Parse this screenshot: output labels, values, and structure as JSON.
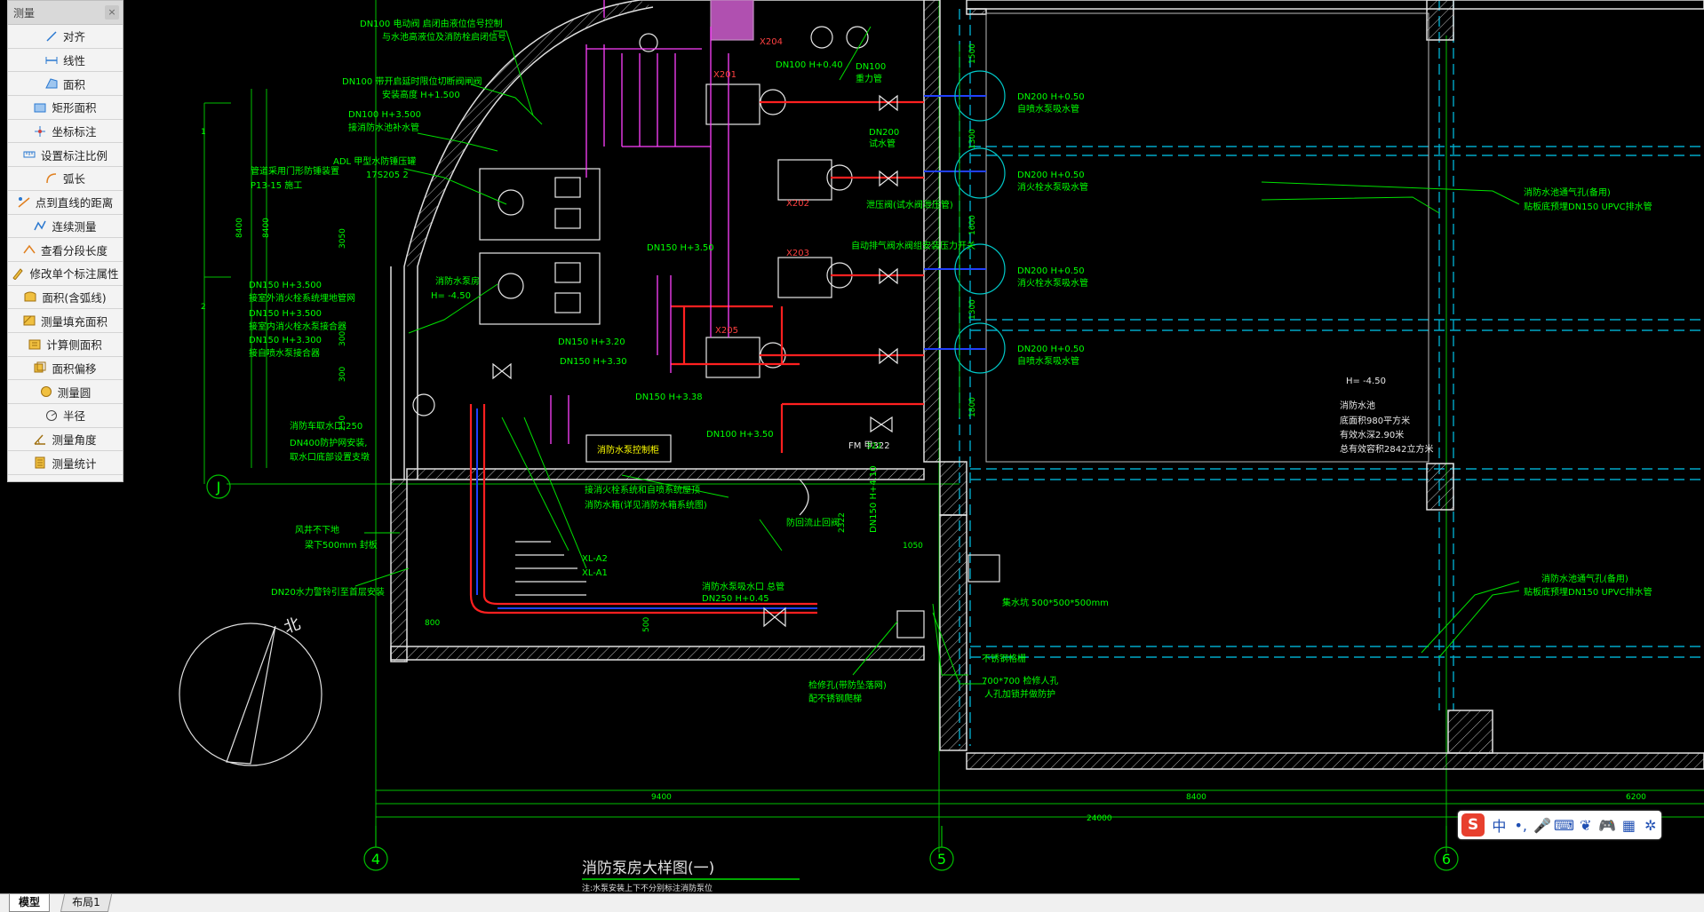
{
  "measure_panel": {
    "title": "测量",
    "close_label": "×",
    "tools": [
      {
        "label": "对齐",
        "icon": "align-icon"
      },
      {
        "label": "线性",
        "icon": "linear-icon"
      },
      {
        "label": "面积",
        "icon": "area-icon"
      },
      {
        "label": "矩形面积",
        "icon": "rect-area-icon"
      },
      {
        "label": "坐标标注",
        "icon": "coordinate-icon"
      },
      {
        "label": "设置标注比例",
        "icon": "scale-icon"
      },
      {
        "label": "弧长",
        "icon": "arc-length-icon"
      },
      {
        "label": "点到直线的距离",
        "icon": "point-line-icon"
      },
      {
        "label": "连续测量",
        "icon": "continuous-icon"
      },
      {
        "label": "查看分段长度",
        "icon": "segment-icon"
      },
      {
        "label": "修改单个标注属性",
        "icon": "edit-dim-icon"
      },
      {
        "label": "面积(含弧线)",
        "icon": "arc-area-icon"
      },
      {
        "label": "测量填充面积",
        "icon": "hatch-area-icon"
      },
      {
        "label": "计算侧面积",
        "icon": "side-area-icon"
      },
      {
        "label": "面积偏移",
        "icon": "area-offset-icon"
      },
      {
        "label": "测量圆",
        "icon": "circle-icon"
      },
      {
        "label": "半径",
        "icon": "radius-icon"
      },
      {
        "label": "测量角度",
        "icon": "angle-icon"
      },
      {
        "label": "测量统计",
        "icon": "stats-icon"
      }
    ]
  },
  "tabs": {
    "model": "模型",
    "layout1": "布局1"
  },
  "ime": {
    "logo": "S",
    "lang": "中",
    "punct": "•,",
    "mic": "🎤",
    "keyboard": "⌨",
    "skin": "❦",
    "game": "🎮",
    "apps": "▦",
    "tools": "✲"
  },
  "drawing": {
    "title": "消防泵房大样图(一)",
    "subtitle": "注:水泵安装上下不分别标注消防泵位",
    "grid_bubbles": {
      "j": "J",
      "g4": "4",
      "g5": "5",
      "g6": "6"
    },
    "dims_bottom": {
      "d1": "9400",
      "d2": "8400",
      "d3": "6200",
      "total": "24000"
    },
    "dims_left": {
      "d1": "8400",
      "d2": "8400",
      "d3": "3050",
      "d4": "300",
      "d5": "300",
      "d6": "250",
      "t1": "1",
      "t2": "2"
    },
    "dims_right": {
      "a": "1500",
      "b": "1300",
      "c": "1600",
      "d": "1300",
      "e": "1800"
    },
    "dims_misc": {
      "a": "800",
      "b": "500",
      "c": "1050",
      "d": "2322",
      "e": "322"
    },
    "labels": {
      "motor_valve": "DN100 电动阀   启闭由液位信号控制",
      "motor_valve2": "与水池高液位及消防栓启闭信号",
      "float_valve": "DN100 带开启延时限位切断阀闸阀",
      "float_valve2": "安装高度    H+1.500",
      "pipe_in": "DN100 H+3.500",
      "pipe_in2": "接消防水池补水管",
      "adl": "ADL 甲型水防锤压罐",
      "adl2": "17S205 2",
      "cabinet": "管道采用门形防锤装置",
      "cabinet2": "P13-15 施工",
      "room": "消防水泵房",
      "room_h": "H= -4.50",
      "p1": "DN150 H+3.500",
      "p1b": "接室外消火栓系统埋地管网",
      "p2": "DN150 H+3.500",
      "p2b": "接室内消火栓水泵接合器",
      "p3": "DN150 H+3.300",
      "p3b": "接自喷水泵接合器",
      "inlet": "消防车取水口 250",
      "inlet2": "DN400防护网安装,",
      "inlet3": "取水口底部设置支墩",
      "shaft": "风井不下地",
      "shaft2": "梁下500mm  封板",
      "pipe_top": "DN20水力警铃引至首层安装",
      "north": "北",
      "xl1": "XL-A2",
      "xl2": "XL-A1",
      "ctrl": "消防水泵控制柜",
      "pump_a": "DN200 H+0.50",
      "pump_a2": "自喷水泵吸水管",
      "pump_b": "DN200 H+0.50",
      "pump_b2": "消火栓水泵吸水管",
      "pump_c": "DN200 H+0.50",
      "pump_c2": "消火栓水泵吸水管",
      "pump_d": "DN200 H+0.50",
      "pump_d2": "自喷水泵吸水管",
      "main": "消防水泵吸水口 总管",
      "main2": "DN250 H+0.45",
      "x201": "X201",
      "x202": "X202",
      "x203": "X203",
      "x204": "X204",
      "x205": "X205",
      "dn100a": "DN100 H+0.40",
      "dn100b": "DN100",
      "dn100b2": "重力管",
      "dn200": "DN200",
      "dn200b": "试水管",
      "relief": "泄压阀(试水阀泄压管)",
      "auto": "自动排气阀水阀组安装压力开关",
      "h350": "DN150 H+3.50",
      "h330": "DN150 H+3.30",
      "h338": "DN150 H+3.38",
      "h356": "DN100 H+3.50",
      "h410": "DN150 H+4.10",
      "h320": "DN150 H+3.20",
      "note1": "接消火栓系统和自喷系统屋顶",
      "note2": "消防水箱(详见消防水箱系统图)",
      "fm": "FM 甲322",
      "fm2": "FM 乙322",
      "fire_net": "防回流止回阀",
      "sump": "集水坑 500*500*500mm",
      "grate": "不锈钢格栅",
      "manhole": "700*700 检修人孔",
      "manhole2": "人孔加锁并做防护",
      "maint": "检修孔(带防坠落网)",
      "maint2": "配不锈钢爬梯",
      "pool_h": "H= -4.50",
      "pool_a": "消防水池",
      "pool_b": "底面积980平方米",
      "pool_c": "有效水深2.90米",
      "pool_d": "总有效容积2842立方米",
      "vent1": "消防水池通气孔(备用)",
      "vent1b": "贴板底预埋DN150 UPVC排水管",
      "vent2": "消防水池通气孔(备用)",
      "vent2b": "贴板底预埋DN150 UPVC排水管"
    }
  }
}
